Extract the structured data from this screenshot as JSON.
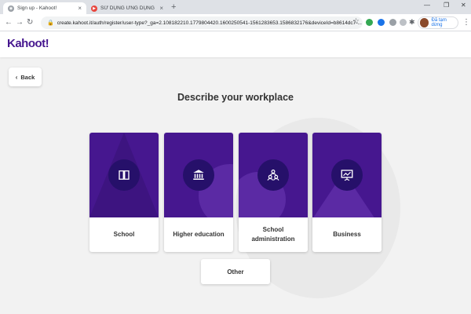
{
  "browser": {
    "tabs": [
      {
        "title": "Sign up - Kahoot!",
        "active": true
      },
      {
        "title": "SỬ DỤNG ỨNG DỤNG KAHOOT",
        "active": false
      }
    ],
    "url": "create.kahoot.it/auth/register/user-type?_ga=2.108182210.1779804420.1600250541-1561283653.1586832176&deviceId=b8614dc7-...",
    "profile_label": "Đã tạm dừng"
  },
  "header": {
    "logo": "Kahoot!"
  },
  "back": {
    "label": "Back"
  },
  "page": {
    "title": "Describe your workplace"
  },
  "options": [
    {
      "label": "School",
      "icon": "book-icon"
    },
    {
      "label": "Higher education",
      "icon": "university-building-icon"
    },
    {
      "label": "School administration",
      "icon": "people-group-icon"
    },
    {
      "label": "Business",
      "icon": "presentation-board-icon"
    }
  ],
  "other": {
    "label": "Other"
  },
  "colors": {
    "brand": "#46178f",
    "icon_circle": "#26106a",
    "background": "#f2f2f2"
  }
}
